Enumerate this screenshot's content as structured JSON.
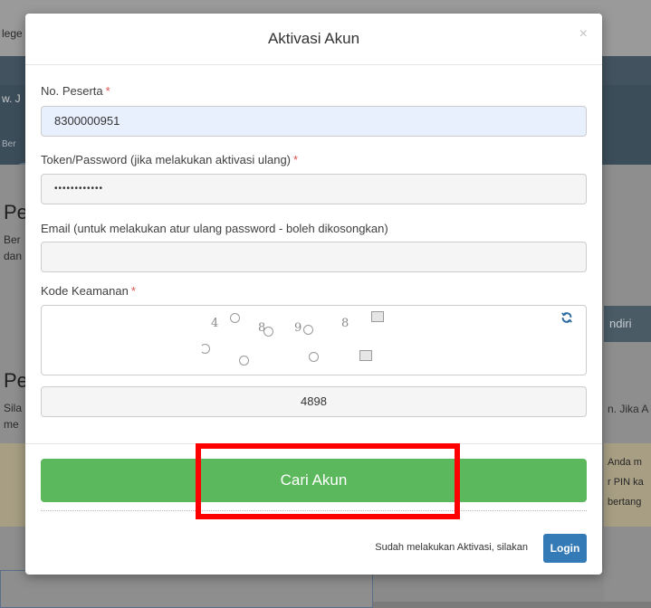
{
  "background": {
    "fragments": {
      "top_left_1": "lege",
      "top_left_2": "w. J",
      "band_left": "Ber",
      "heading_1": "Pe",
      "para_1a": "Ber",
      "para_1b": "dan",
      "heading_2": "Pe",
      "para_2a": "Sila",
      "para_2b": "me",
      "right_pill": "ndiri",
      "right_text": "n. Jika A",
      "warning_1": "Anda m",
      "warning_2": "r PIN ka",
      "warning_3": "bertang"
    }
  },
  "modal": {
    "title": "Aktivasi Akun",
    "close_label": "×",
    "fields": {
      "no_peserta": {
        "label": "No. Peserta",
        "required_mark": "*",
        "value": "8300000951"
      },
      "token": {
        "label": "Token/Password (jika melakukan aktivasi ulang)",
        "required_mark": "*",
        "value": "••••••••••••"
      },
      "email": {
        "label": "Email (untuk melakukan atur ulang password - boleh dikosongkan)",
        "value": ""
      },
      "kode_keamanan": {
        "label": "Kode Keamanan",
        "required_mark": "*",
        "captcha_chars": [
          "4",
          "8",
          "9",
          "8"
        ],
        "value": "4898"
      }
    },
    "submit_button": "Cari Akun",
    "footer_note": "Sudah melakukan Aktivasi, silakan",
    "login_button": "Login"
  },
  "colors": {
    "primary_green": "#5cb85c",
    "login_blue": "#337ab7",
    "required_red": "#d9534f",
    "highlight_red": "#ff0000"
  }
}
